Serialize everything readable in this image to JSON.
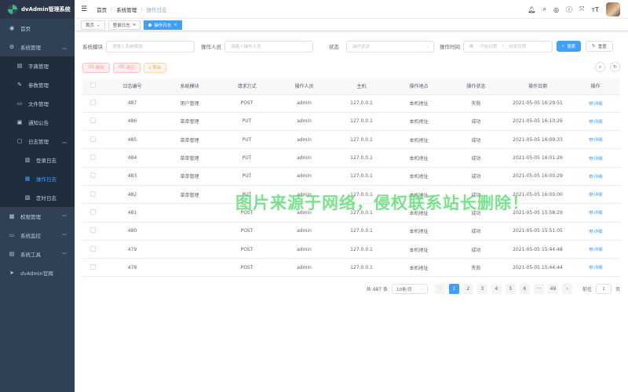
{
  "app": {
    "title": "dvAdmin管理系统"
  },
  "sidebar": {
    "items": [
      {
        "label": "首页",
        "icon": "dashboard-icon"
      },
      {
        "label": "系统管理",
        "icon": "gear-icon"
      },
      {
        "label": "字典管理",
        "icon": "book-icon"
      },
      {
        "label": "参数管理",
        "icon": "edit-icon"
      },
      {
        "label": "文件管理",
        "icon": "folder-icon"
      },
      {
        "label": "通知公告",
        "icon": "message-icon"
      },
      {
        "label": "日志管理",
        "icon": "log-icon"
      },
      {
        "label": "登录日志",
        "icon": "login-log-icon"
      },
      {
        "label": "操作日志",
        "icon": "operation-log-icon"
      },
      {
        "label": "定时日志",
        "icon": "timer-log-icon"
      },
      {
        "label": "权限管理",
        "icon": "lock-icon"
      },
      {
        "label": "系统监控",
        "icon": "monitor-icon"
      },
      {
        "label": "系统工具",
        "icon": "tool-icon"
      },
      {
        "label": "dvAdmin官网",
        "icon": "send-icon"
      }
    ]
  },
  "header": {
    "breadcrumb": [
      "首页",
      "系统管理",
      "操作日志"
    ]
  },
  "tags": [
    {
      "label": "首页"
    },
    {
      "label": "登录日志"
    },
    {
      "label": "操作日志"
    }
  ],
  "filters": {
    "module_label": "系统模块",
    "module_placeholder": "请输入系统模块",
    "operator_label": "操作人员",
    "operator_placeholder": "请输入操作人员",
    "status_label": "状态",
    "status_placeholder": "操作状态",
    "time_label": "操作时间",
    "start_placeholder": "开始日期",
    "range_sep": "-",
    "end_placeholder": "结束日期",
    "search_label": "搜索",
    "reset_label": "重置"
  },
  "toolbar": {
    "delete_label": "删除",
    "clear_label": "清空",
    "export_label": "导出"
  },
  "table": {
    "headers": [
      "日志编号",
      "系统模块",
      "请求方式",
      "操作人员",
      "主机",
      "操作地点",
      "操作状态",
      "操作日期",
      "操作"
    ],
    "detail_label": "详细",
    "rows": [
      [
        "487",
        "用户管理",
        "POST",
        "admin",
        "127.0.0.1",
        "本机地址",
        "失败",
        "2021-05-05 16:29:51"
      ],
      [
        "486",
        "菜单管理",
        "PUT",
        "admin",
        "127.0.0.1",
        "本机地址",
        "成功",
        "2021-05-05 16:10:26"
      ],
      [
        "485",
        "菜单管理",
        "PUT",
        "admin",
        "127.0.0.1",
        "本机地址",
        "成功",
        "2021-05-05 16:09:33"
      ],
      [
        "484",
        "菜单管理",
        "PUT",
        "admin",
        "127.0.0.1",
        "本机地址",
        "成功",
        "2021-05-05 16:01:26"
      ],
      [
        "483",
        "菜单管理",
        "PUT",
        "admin",
        "127.0.0.1",
        "本机地址",
        "成功",
        "2021-05-05 16:00:29"
      ],
      [
        "482",
        "菜单管理",
        "PUT",
        "admin",
        "127.0.0.1",
        "本机地址",
        "成功",
        "2021-05-05 16:00:00"
      ],
      [
        "481",
        "",
        "POST",
        "admin",
        "127.0.0.1",
        "本机地址",
        "成功",
        "2021-05-05 15:58:29"
      ],
      [
        "480",
        "",
        "POST",
        "admin",
        "127.0.0.1",
        "本机地址",
        "成功",
        "2021-05-05 15:51:05"
      ],
      [
        "479",
        "",
        "POST",
        "admin",
        "127.0.0.1",
        "本机地址",
        "成功",
        "2021-05-05 15:44:48"
      ],
      [
        "478",
        "",
        "POST",
        "admin",
        "127.0.0.1",
        "本机地址",
        "失败",
        "2021-05-05 15:44:44"
      ]
    ]
  },
  "pagination": {
    "total_text": "共 487 条",
    "page_size": "10条/页",
    "pages": [
      "1",
      "2",
      "3",
      "4",
      "5",
      "6",
      "···",
      "49"
    ],
    "current": "1",
    "goto_label": "前往",
    "goto_value": "1",
    "page_unit": "页"
  },
  "watermark": "图片来源于网络，侵权联系站长删除！",
  "colors": {
    "primary": "#409eff",
    "sidebar": "#304156",
    "watermark": "#4cd964"
  }
}
